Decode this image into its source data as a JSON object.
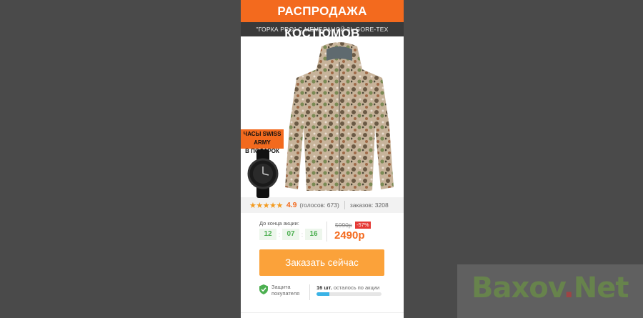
{
  "banner": {
    "title": "РАСПРОДАЖА КОСТЮМОВ"
  },
  "product": {
    "subtitle": "\"ГОРКА PRO\" С МЕМБРАНОЙ 3L GORE-TEX"
  },
  "promo": {
    "line1": "ЧАСЫ SWISS ARMY",
    "line2": "В ПОДАРОК"
  },
  "rating": {
    "stars": "★★★★★",
    "score": "4.9",
    "votes": "(голосов: 673)",
    "orders": "заказов: 3208"
  },
  "timer": {
    "label": "До конца акции:",
    "hours": "12",
    "minutes": "07",
    "seconds": "16",
    "separator": ":"
  },
  "price": {
    "old": "5990р",
    "discount": "-57%",
    "new": "2490р"
  },
  "cta": {
    "label": "Заказать сейчас"
  },
  "protection": {
    "text": "Защита покупателя"
  },
  "stock": {
    "count": "16 шт.",
    "text": "осталось по акции",
    "fill_fraction": 0.2
  },
  "watermark": {
    "text_a": "Baxov",
    "text_dot": ".",
    "text_b": "Net"
  },
  "colors": {
    "accent": "#f36a1e",
    "button": "#fba23a",
    "timer_green": "#4caf50",
    "discount_red": "#e53935",
    "stock_bar": "#3ab3e6",
    "background": "#4a4a4a"
  },
  "icons": [
    "star-icon",
    "shield-check-icon",
    "jacket-image",
    "watch-image"
  ]
}
